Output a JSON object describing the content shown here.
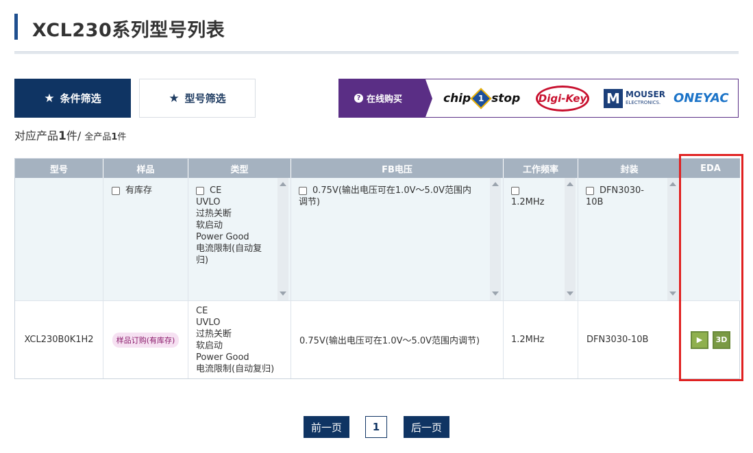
{
  "page": {
    "title": "XCL230系列型号列表"
  },
  "tabs": [
    {
      "label": "条件筛选",
      "active": true
    },
    {
      "label": "型号筛选",
      "active": false
    }
  ],
  "buy": {
    "label": "在线购买",
    "vendors": [
      "chip 1 stop",
      "Digi-Key",
      "MOUSER ELECTRONICS",
      "ONEYAC"
    ],
    "chip_a": "chip",
    "chip_one": "1",
    "chip_b": "stop",
    "digikey": "Digi-Key",
    "mouser_m": "M",
    "mouser_a": "MOUSER",
    "mouser_b": "ELECTRONICS.",
    "oneyac": "ONEYAC"
  },
  "results": {
    "prefix": "对应产品",
    "count": "1",
    "suffix": "件/",
    "total_prefix": "全产品",
    "total": "1",
    "total_suffix": "件"
  },
  "table": {
    "headers": [
      "型号",
      "样品",
      "类型",
      "FB电压",
      "工作频率",
      "封装",
      "EDA"
    ],
    "filters": {
      "sample": "有库存",
      "type": [
        "CE",
        "UVLO",
        "过热关断",
        "软启动",
        "Power Good",
        "电流限制(自动复",
        "归)"
      ],
      "fb": [
        "0.75V(输出电压可在1.0V～5.0V范围内",
        "调节)"
      ],
      "freq": "1.2MHz",
      "package": [
        "DFN3030-",
        "10B"
      ]
    },
    "row": {
      "model": "XCL230B0K1H2",
      "sample_badge": "样品订购(有库存)",
      "type": [
        "CE",
        "UVLO",
        "过热关断",
        "软启动",
        "Power Good",
        "电流限制(自动复归)"
      ],
      "fb": "0.75V(输出电压可在1.0V～5.0V范围内调节)",
      "freq": "1.2MHz",
      "package": "DFN3030-10B",
      "eda_3d": "3D"
    }
  },
  "pager": {
    "prev": "前一页",
    "page": "1",
    "next": "后一页"
  },
  "colors": {
    "navy": "#0f3463",
    "purple": "#5a2e85",
    "header": "#a5b2c0",
    "highlight": "#e02020"
  }
}
